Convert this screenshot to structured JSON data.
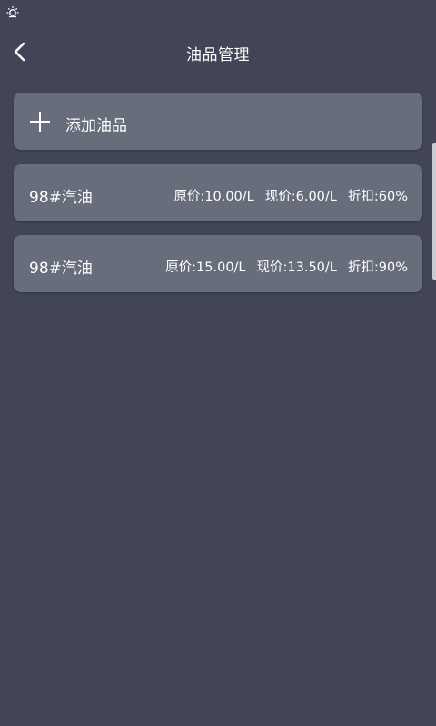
{
  "status_bar": {
    "icons": [
      "notification-sun-icon"
    ]
  },
  "header": {
    "title": "油品管理",
    "back_icon": "chevron-left-icon"
  },
  "add_item": {
    "icon": "plus-icon",
    "label": "添加油品"
  },
  "oil_items": [
    {
      "name": "98#汽油",
      "original": "原价:10.00/L",
      "current": "现价:6.00/L",
      "discount": "折扣:60%"
    },
    {
      "name": "98#汽油",
      "original": "原价:15.00/L",
      "current": "现价:13.50/L",
      "discount": "折扣:90%"
    }
  ],
  "colors": {
    "background": "#414555",
    "card": "#686d7b",
    "text": "#ffffff"
  }
}
